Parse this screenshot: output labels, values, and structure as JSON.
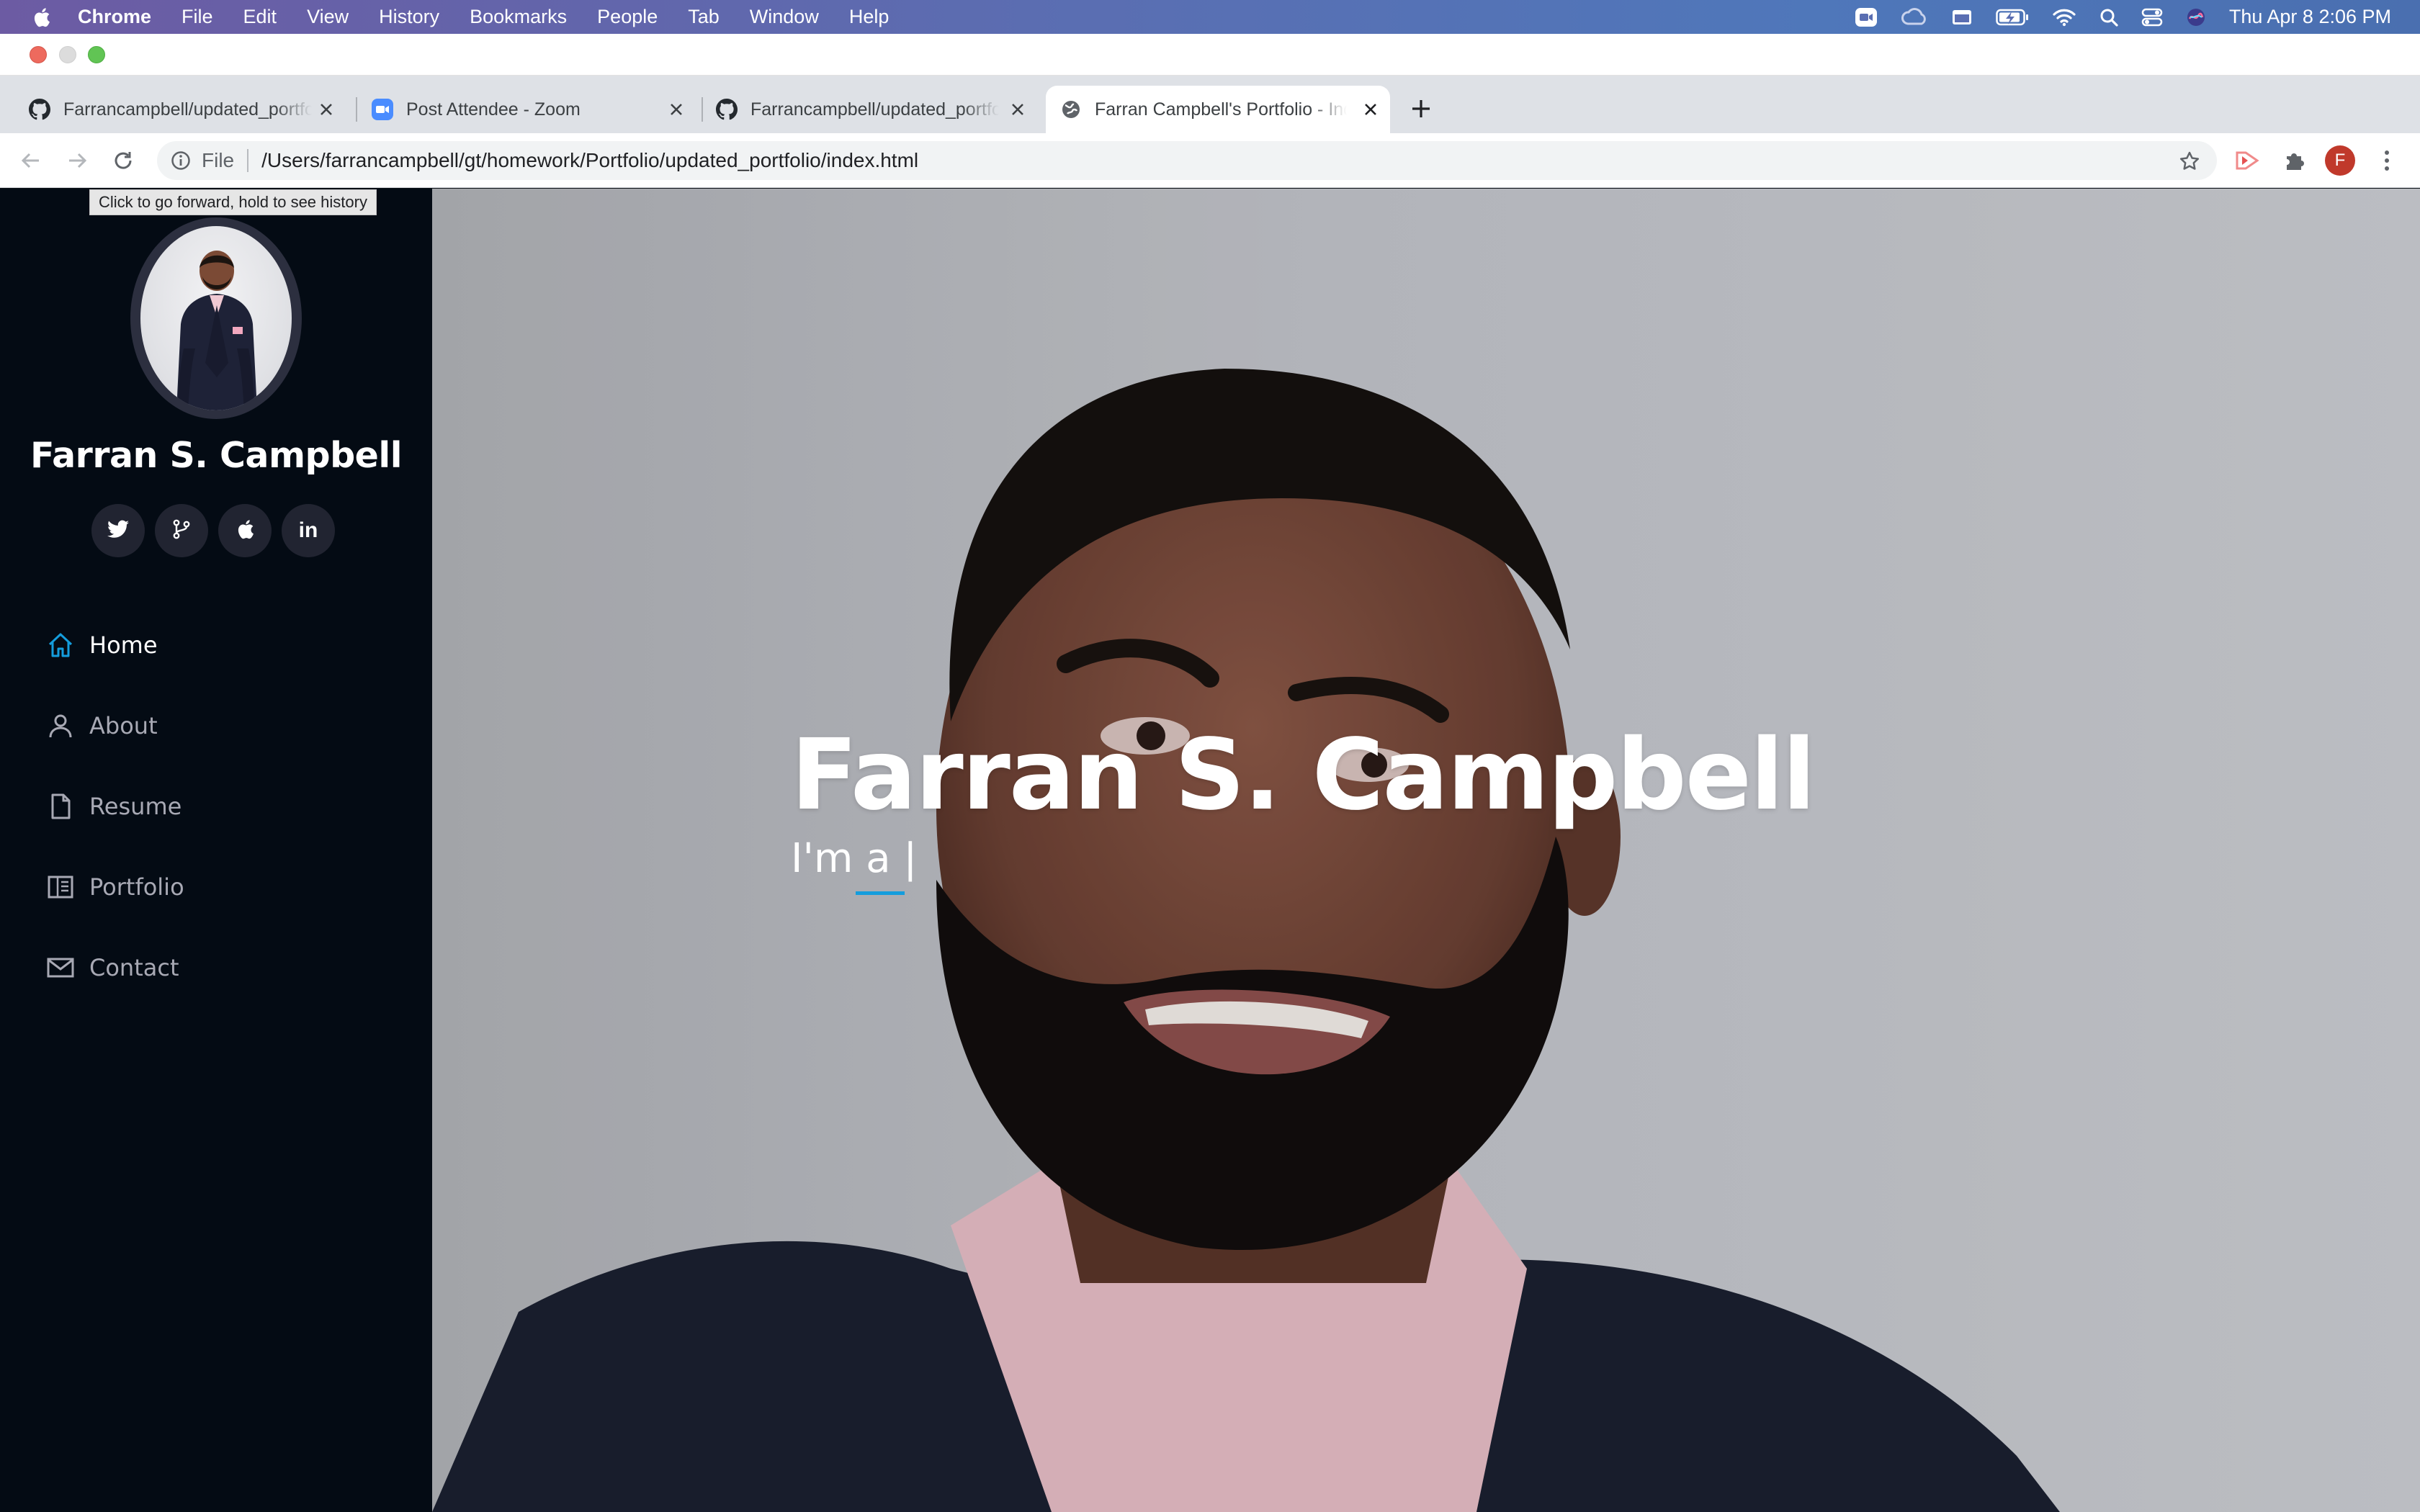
{
  "menubar": {
    "app_name": "Chrome",
    "items": [
      "File",
      "Edit",
      "View",
      "History",
      "Bookmarks",
      "People",
      "Tab",
      "Window",
      "Help"
    ],
    "clock": "Thu Apr 8  2:06 PM"
  },
  "tabs": [
    {
      "title": "Farrancampbell/updated_portfolio",
      "favicon": "github-icon",
      "active": false
    },
    {
      "title": "Post Attendee - Zoom",
      "favicon": "zoom-icon",
      "active": false
    },
    {
      "title": "Farrancampbell/updated_portfolio",
      "favicon": "github-icon",
      "active": false
    },
    {
      "title": "Farran Campbell's Portfolio - Index",
      "favicon": "globe-icon",
      "active": true
    }
  ],
  "omnibox": {
    "scheme": "File",
    "url": "/Users/farrancampbell/gt/homework/Portfolio/updated_portfolio/index.html"
  },
  "profile_initial": "F",
  "tooltip": "Click to go forward, hold to see history",
  "sidebar": {
    "name": "Farran S. Campbell",
    "socials": [
      "twitter-icon",
      "git-branch-icon",
      "apple-icon",
      "linkedin-icon"
    ],
    "linkedin_label": "in",
    "nav": [
      {
        "label": "Home",
        "icon": "home-icon",
        "active": true
      },
      {
        "label": "About",
        "icon": "person-icon",
        "active": false
      },
      {
        "label": "Resume",
        "icon": "file-icon",
        "active": false
      },
      {
        "label": "Portfolio",
        "icon": "book-icon",
        "active": false
      },
      {
        "label": "Contact",
        "icon": "envelope-icon",
        "active": false
      }
    ]
  },
  "hero": {
    "title": "Farran S. Campbell",
    "typed": "I'm a |"
  },
  "colors": {
    "sidebar_bg": "#040b14",
    "accent": "#149ddd",
    "social_bg": "#212431"
  }
}
